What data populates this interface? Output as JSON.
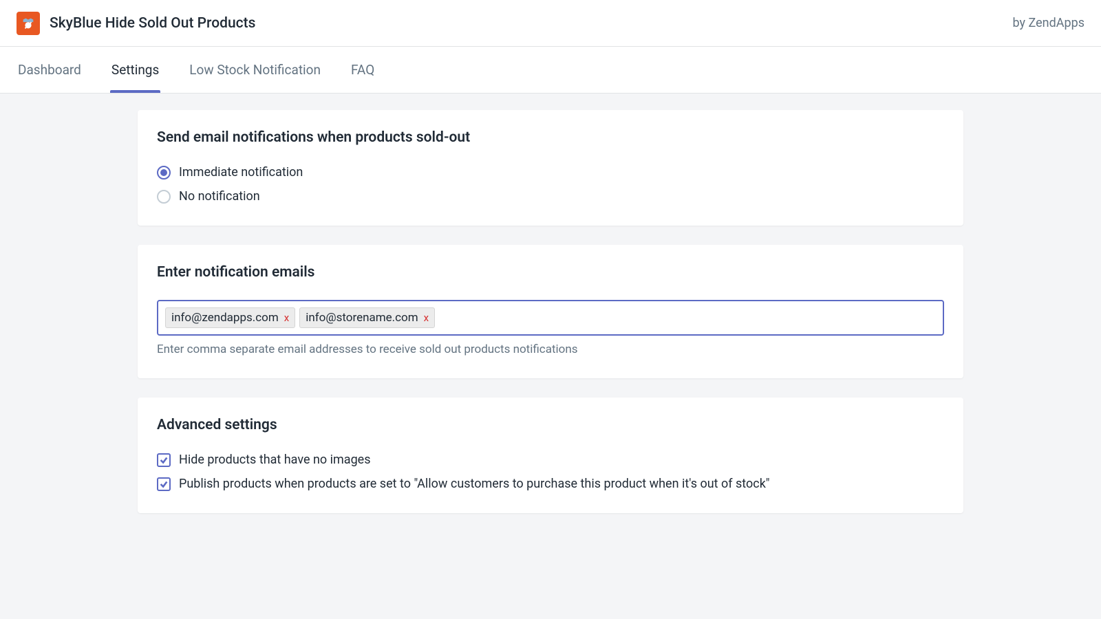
{
  "header": {
    "app_title": "SkyBlue Hide Sold Out Products",
    "byline": "by ZendApps"
  },
  "tabs": [
    {
      "label": "Dashboard",
      "active": false
    },
    {
      "label": "Settings",
      "active": true
    },
    {
      "label": "Low Stock Notification",
      "active": false
    },
    {
      "label": "FAQ",
      "active": false
    }
  ],
  "cards": {
    "notifications": {
      "title": "Send email notifications when products sold-out",
      "options": [
        {
          "label": "Immediate notification",
          "selected": true
        },
        {
          "label": "No notification",
          "selected": false
        }
      ]
    },
    "emails": {
      "title": "Enter notification emails",
      "tags": [
        "info@zendapps.com",
        "info@storename.com"
      ],
      "remove_glyph": "x",
      "help_text": "Enter comma separate email addresses to receive sold out products notifications"
    },
    "advanced": {
      "title": "Advanced settings",
      "options": [
        {
          "label": "Hide products that have no images",
          "checked": true
        },
        {
          "label": "Publish products when products are set to \"Allow customers to purchase this product when it's out of stock\"",
          "checked": true
        }
      ]
    }
  }
}
